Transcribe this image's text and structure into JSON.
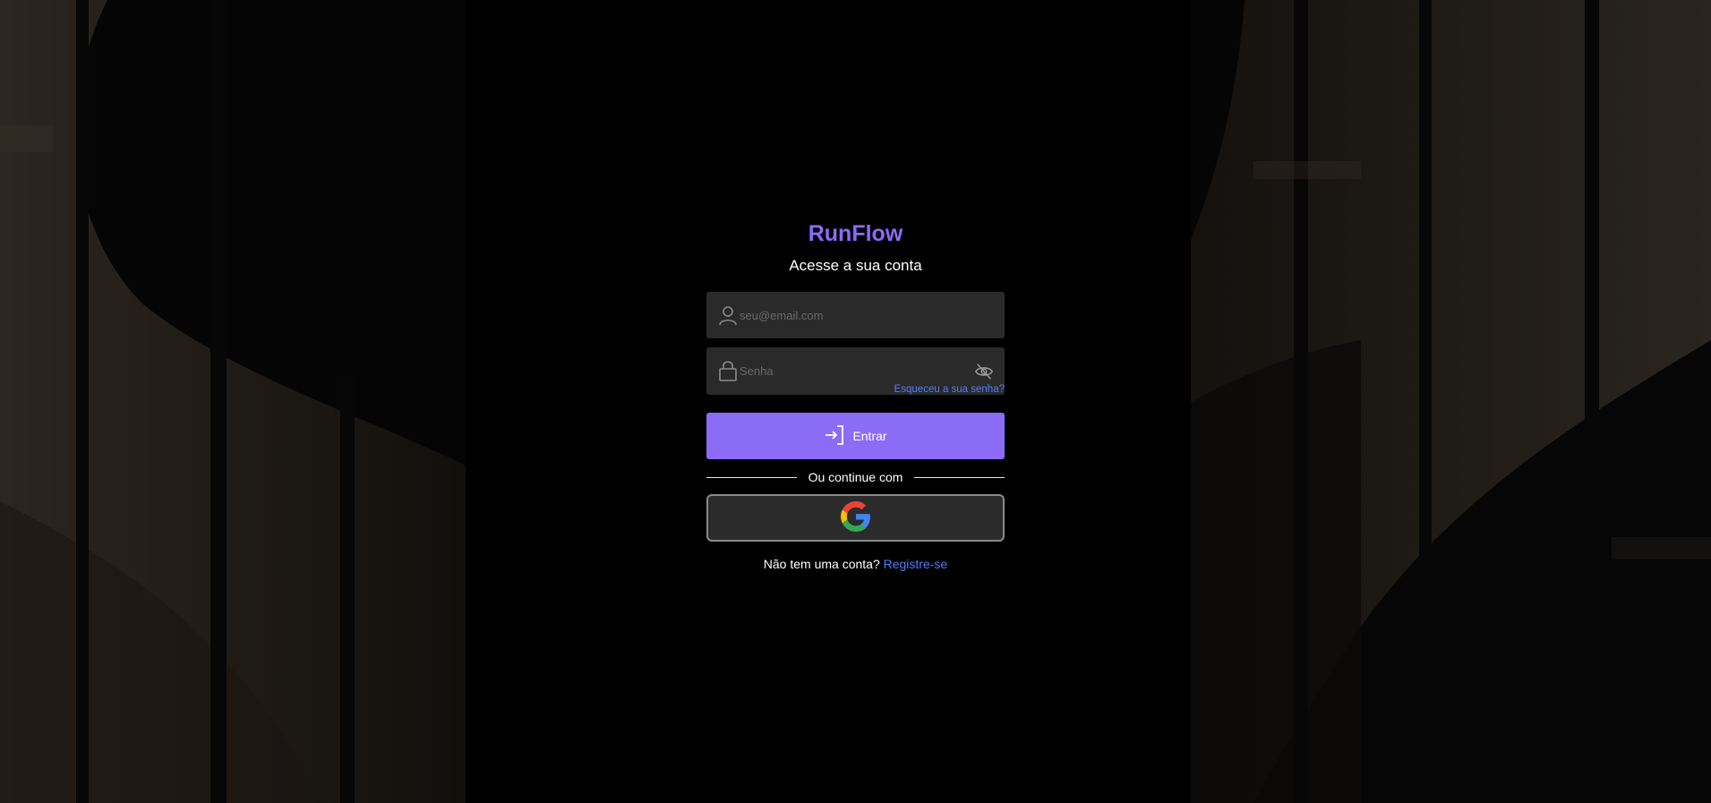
{
  "brand": {
    "name": "RunFlow",
    "color": "#8b6cf6"
  },
  "login": {
    "subtitle": "Acesse a sua conta",
    "email": {
      "placeholder": "seu@email.com",
      "value": "",
      "icon": "user-icon"
    },
    "password": {
      "placeholder": "Senha",
      "value": "",
      "icon": "lock-icon",
      "toggle_icon": "eye-off-icon"
    },
    "forgot_label": "Esqueceu a sua senha?",
    "submit_label": "Entrar",
    "submit_icon": "login-icon",
    "divider_label": "Ou continue com",
    "google_icon": "google-icon",
    "signup_prompt": "Não tem uma conta?",
    "signup_link": "Registre-se"
  },
  "colors": {
    "accent": "#8b6cf6",
    "link": "#4f7dff",
    "field_bg": "#2a2a2a",
    "background": "#000000"
  }
}
